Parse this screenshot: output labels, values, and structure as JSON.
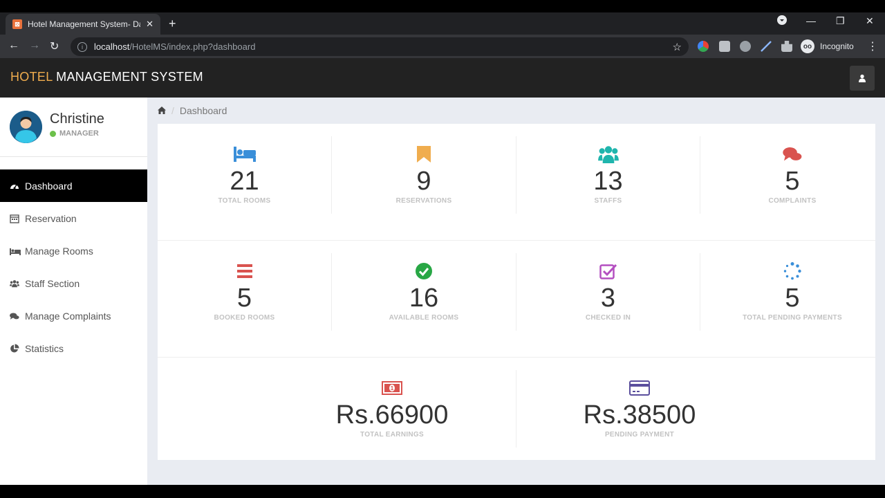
{
  "browser": {
    "tab_title": "Hotel Management System- Dash",
    "url_host": "localhost",
    "url_path": "/HotelMS/index.php?dashboard",
    "incognito_label": "Incognito"
  },
  "app": {
    "brand_part1": "HOTEL",
    "brand_part2": "MANAGEMENT SYSTEM",
    "brand_color": "#f0ad4e"
  },
  "user": {
    "name": "Christine",
    "role": "MANAGER"
  },
  "sidebar": {
    "items": [
      {
        "label": "Dashboard",
        "icon": "dashboard-icon",
        "active": true
      },
      {
        "label": "Reservation",
        "icon": "calendar-icon"
      },
      {
        "label": "Manage Rooms",
        "icon": "bed-icon"
      },
      {
        "label": "Staff Section",
        "icon": "users-icon"
      },
      {
        "label": "Manage Complaints",
        "icon": "comments-icon"
      },
      {
        "label": "Statistics",
        "icon": "pie-chart-icon"
      }
    ]
  },
  "breadcrumb": {
    "current": "Dashboard"
  },
  "stats": {
    "row1": [
      {
        "value": "21",
        "label": "TOTAL ROOMS",
        "icon": "bed-icon",
        "color": "#3a8fd9"
      },
      {
        "value": "9",
        "label": "RESERVATIONS",
        "icon": "bookmark-icon",
        "color": "#f0ad4e"
      },
      {
        "value": "13",
        "label": "STAFFS",
        "icon": "users-icon",
        "color": "#1fb5ad"
      },
      {
        "value": "5",
        "label": "COMPLAINTS",
        "icon": "comments-icon",
        "color": "#d9534f"
      }
    ],
    "row2": [
      {
        "value": "5",
        "label": "BOOKED ROOMS",
        "icon": "bars-icon",
        "color": "#d9534f"
      },
      {
        "value": "16",
        "label": "AVAILABLE ROOMS",
        "icon": "check-circle-icon",
        "color": "#28a745"
      },
      {
        "value": "3",
        "label": "CHECKED IN",
        "icon": "check-square-icon",
        "color": "#b44fc0"
      },
      {
        "value": "5",
        "label": "TOTAL PENDING PAYMENTS",
        "icon": "spinner-icon",
        "color": "#3a8fd9"
      }
    ],
    "row3": [
      {
        "value": "Rs.66900",
        "label": "TOTAL EARNINGS",
        "icon": "money-icon",
        "color": "#d9534f"
      },
      {
        "value": "Rs.38500",
        "label": "PENDING PAYMENT",
        "icon": "credit-card-icon",
        "color": "#5a4e9c"
      }
    ]
  }
}
